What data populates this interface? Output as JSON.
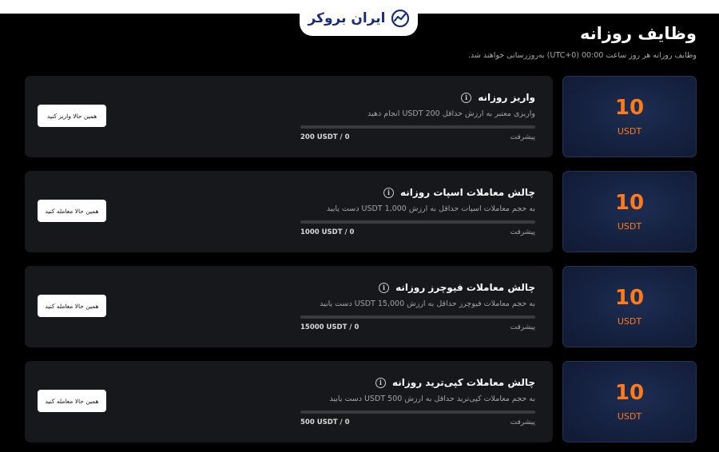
{
  "header": {
    "logo_text": "ایران بروکر",
    "title": "وظایف روزانه",
    "subtitle": "وظایف روزانه هر روز ساعت 00:00 (UTC+0) به‌روزرسانی خواهند شد."
  },
  "colors": {
    "accent": "#ff7a1a",
    "card_bg": "#17181c",
    "reward_bg": "#14203e",
    "brand": "#1a2c7a"
  },
  "tasks": [
    {
      "title": "واریز روزانه",
      "description": "واریزی معتبر به ارزش حداقل 200 USDT انجام دهید",
      "progress_label": "پیشرفت",
      "progress_current": "0",
      "progress_target": "200 USDT",
      "progress_fraction": 0,
      "button_label": "همین حالا واریز کنید",
      "reward_amount": "10",
      "reward_unit": "USDT"
    },
    {
      "title": "چالش معاملات اسپات روزانه",
      "description": "به حجم معاملات اسپات حداقل به ارزش 1,000 USDT دست یابید",
      "progress_label": "پیشرفت",
      "progress_current": "0",
      "progress_target": "1000 USDT",
      "progress_fraction": 0,
      "button_label": "همین حالا معامله کنید",
      "reward_amount": "10",
      "reward_unit": "USDT"
    },
    {
      "title": "چالش معاملات فیوچرز روزانه",
      "description": "به حجم معاملات فیوچرز حداقل به ارزش 15,000 USDT دست یابید",
      "progress_label": "پیشرفت",
      "progress_current": "0",
      "progress_target": "15000 USDT",
      "progress_fraction": 0,
      "button_label": "همین حالا معامله کنید",
      "reward_amount": "10",
      "reward_unit": "USDT"
    },
    {
      "title": "چالش معاملات کپی‌ترید روزانه",
      "description": "به حجم معاملات کپی‌ترید حداقل به ارزش 500 USDT دست یابید",
      "progress_label": "پیشرفت",
      "progress_current": "0",
      "progress_target": "500 USDT",
      "progress_fraction": 0,
      "button_label": "همین حالا معامله کنید",
      "reward_amount": "10",
      "reward_unit": "USDT"
    }
  ]
}
